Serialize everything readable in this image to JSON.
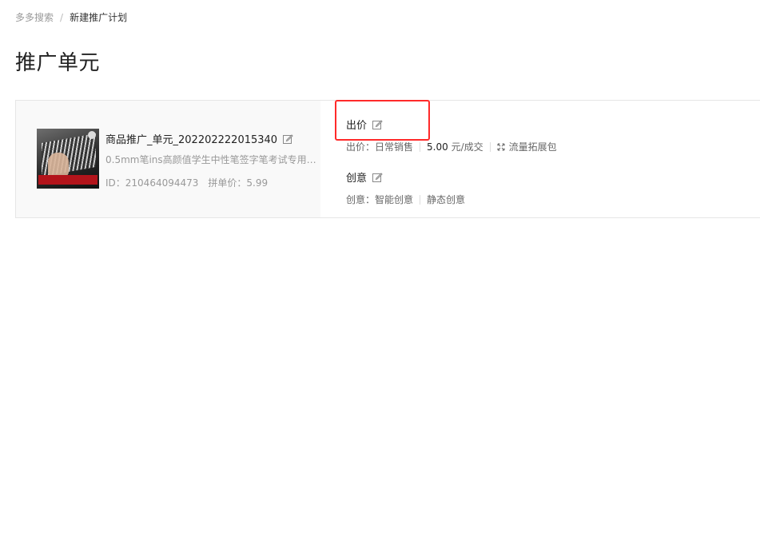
{
  "breadcrumb": {
    "items": [
      "多多搜索",
      "新建推广计划"
    ],
    "separator": "/"
  },
  "page_title": "推广单元",
  "unit": {
    "goods_name": "商品推广_单元_202202222015340",
    "goods_desc": "0.5mm笔ins高颜值学生中性笔签字笔考试专用笔...",
    "goods_id": "ID：210464094473",
    "group_price": "拼单价：5.99",
    "bid": {
      "title": "出价",
      "mode": "出价：日常销售",
      "value": "5.00",
      "unit": "元/成交",
      "traffic_pack": "流量拓展包"
    },
    "creative": {
      "title": "创意",
      "mode": "创意：智能创意",
      "type": "静态创意"
    }
  },
  "colors": {
    "highlight": "#ff2a2a",
    "panel_bg": "#f9f9f9",
    "border": "#e6e6e6"
  },
  "icons": [
    "edit-icon",
    "expand-icon"
  ]
}
